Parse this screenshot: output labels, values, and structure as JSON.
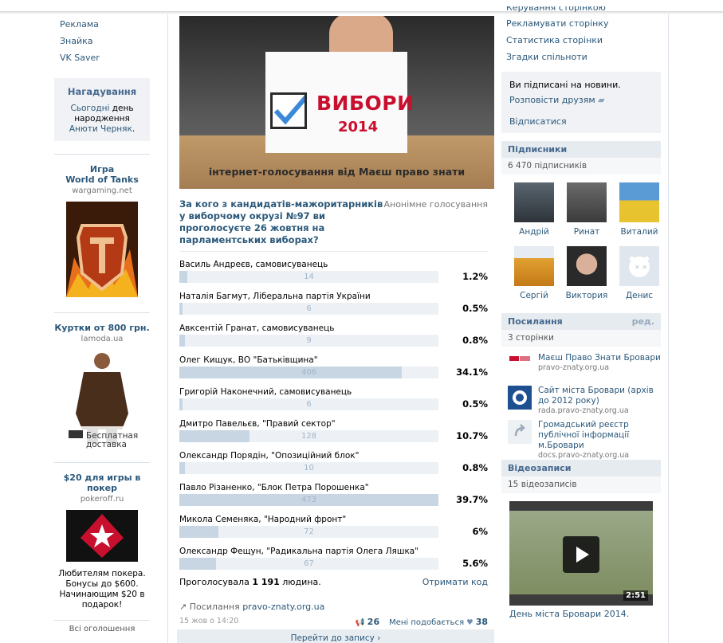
{
  "left_menu": [
    "Реклама",
    "Знайка",
    "VK Saver"
  ],
  "reminder": {
    "title": "Нагадування",
    "today": "Сьогодні",
    "text1": "день народження",
    "person": "Анюти Черняк",
    "dot": "."
  },
  "ads": [
    {
      "title": "Игра\nWorld of Tanks",
      "domain": "wargaming.net",
      "desc": ""
    },
    {
      "title": "Куртки от 800 грн.",
      "domain": "lamoda.ua",
      "desc": "",
      "badge": "Бесплатная доставка"
    },
    {
      "title": "$20 для игры в покер",
      "domain": "pokeroff.ru",
      "desc": "Любителям покера. Бонусы до $600. Начинающим $20 в подарок!"
    }
  ],
  "all_ads": "Всі оголошення",
  "poster": {
    "title": "ВИБОРИ",
    "year": "2014",
    "caption": "інтернет-голосування від Маєш право знати"
  },
  "poll": {
    "question": "За кого з кандидатів-мажоритарників у виборчому окрузі №97 ви проголосуєте 26 жовтня на парламентських виборах?",
    "type": "Анонімне голосування",
    "answers": [
      {
        "name": "Василь Андреєв, самовисуванець",
        "count": "14",
        "pct": "1.2%",
        "share": 0.012
      },
      {
        "name": "Наталія Багмут, Ліберальна партія України",
        "count": "6",
        "pct": "0.5%",
        "share": 0.005
      },
      {
        "name": "Авксентій Гранат, самовисуванець",
        "count": "9",
        "pct": "0.8%",
        "share": 0.008
      },
      {
        "name": "Олег Кищук, ВО \"Батьківщина\"",
        "count": "406",
        "pct": "34.1%",
        "share": 0.341
      },
      {
        "name": "Григорій Наконечний, самовисуванець",
        "count": "6",
        "pct": "0.5%",
        "share": 0.005
      },
      {
        "name": "Дмитро Павельєв, \"Правий сектор\"",
        "count": "128",
        "pct": "10.7%",
        "share": 0.107
      },
      {
        "name": "Олександр Порядін, \"Опозиційний блок\"",
        "count": "10",
        "pct": "0.8%",
        "share": 0.008
      },
      {
        "name": "Павло Різаненко, \"Блок Петра Порошенка\"",
        "count": "473",
        "pct": "39.7%",
        "share": 0.397
      },
      {
        "name": "Микола Семеняка, \"Народний фронт\"",
        "count": "72",
        "pct": "6%",
        "share": 0.06
      },
      {
        "name": "Олександр Фещун, \"Радикальна партія Олега Ляшка\"",
        "count": "67",
        "pct": "5.6%",
        "share": 0.056
      }
    ],
    "voted_prefix": "Проголосувала",
    "voted_count": "1 191",
    "voted_suffix": "людина.",
    "get_code": "Отримати код"
  },
  "post": {
    "source_label": "Посилання",
    "source_link": "pravo-znaty.org.ua",
    "date": "15 жов о 14:20",
    "reposts": "26",
    "likes_label": "Мені подобається",
    "likes": "38",
    "goto": "Перейти до запису"
  },
  "right_menu": [
    "Керування сторінкою",
    "Рекламувати сторінку",
    "Статистика сторінки",
    "Згадки спільноти"
  ],
  "subscription": {
    "status": "Ви підписані на новини.",
    "tell": "Розповісти друзям",
    "unsubscribe": "Відписатися"
  },
  "subscribers": {
    "title": "Підписники",
    "count": "6 470 підписників",
    "members": [
      "Андрій",
      "Ринат",
      "Виталий",
      "Сергій",
      "Виктория",
      "Денис"
    ]
  },
  "links": {
    "title": "Посилання",
    "edit": "ред.",
    "count": "3 сторінки",
    "items": [
      {
        "title": "Маєш Право Знати Бровари",
        "domain": "pravo-znaty.org.ua"
      },
      {
        "title": "Сайт міста Бровари (архів до 2012 року)",
        "domain": "rada.pravo-znaty.org.ua"
      },
      {
        "title": "Громадський реєстр публічної інформації м.Бровари",
        "domain": "docs.pravo-znaty.org.ua"
      }
    ]
  },
  "videos": {
    "title": "Відеозаписи",
    "count": "15 відеозаписів",
    "duration": "2:51",
    "video_title": "День міста Бровари 2014."
  }
}
